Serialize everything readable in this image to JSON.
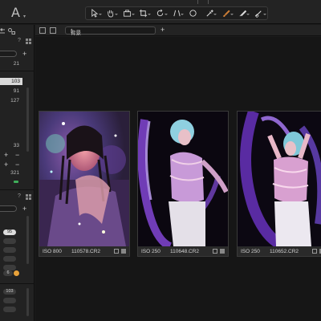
{
  "toolbar": {
    "app_glyph": "A",
    "tools": [
      {
        "name": "select-tool",
        "icon": "arrow-cursor-icon"
      },
      {
        "name": "pan-tool",
        "icon": "hand-icon"
      },
      {
        "name": "camera-tool",
        "icon": "camera-icon"
      },
      {
        "name": "crop-tool",
        "icon": "crop-icon"
      },
      {
        "name": "rotate-tool",
        "icon": "rotate-icon"
      },
      {
        "name": "keystone-tool",
        "icon": "keystone-icon"
      },
      {
        "name": "spot-tool",
        "icon": "circle-icon"
      },
      {
        "name": "picker-tool",
        "icon": "eyedropper-icon"
      },
      {
        "name": "brush-tool",
        "icon": "brush-icon",
        "color": "#e0893a"
      },
      {
        "name": "eraser-tool",
        "icon": "eraser-icon"
      },
      {
        "name": "gradient-tool",
        "icon": "gradient-icon"
      }
    ]
  },
  "browser": {
    "album_name": "背景",
    "images": [
      {
        "iso": "ISO 800",
        "filename": "110578.CR2"
      },
      {
        "iso": "ISO 250",
        "filename": "110648.CR2"
      },
      {
        "iso": "ISO 250",
        "filename": "110652.CR2"
      }
    ]
  },
  "left_panel": {
    "counts_a": {
      "top": "21",
      "selected": "103",
      "rows": [
        "91",
        "127"
      ]
    },
    "counts_b": {
      "top": "33",
      "value": "321"
    },
    "pills": [
      "95",
      "",
      "",
      "",
      "",
      "6"
    ],
    "pills2": [
      "103",
      "",
      ""
    ],
    "question": "?"
  }
}
